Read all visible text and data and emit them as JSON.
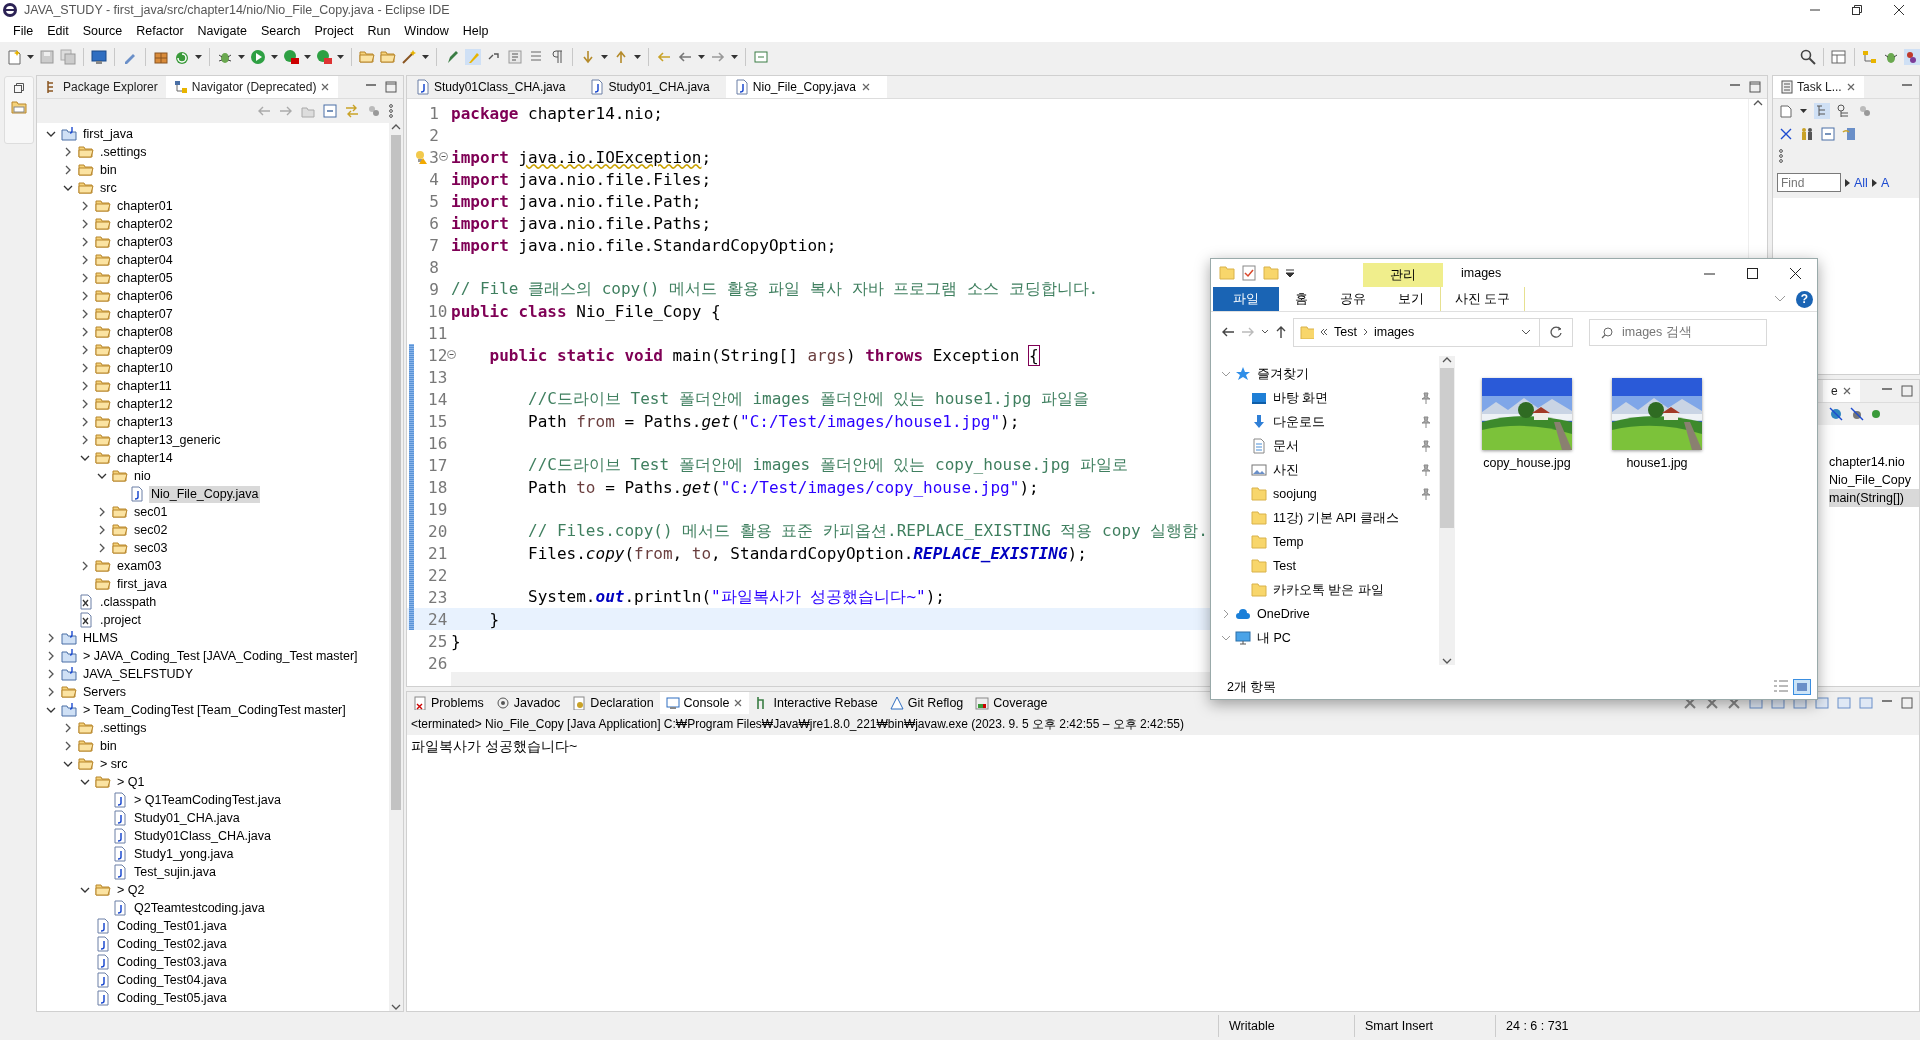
{
  "window": {
    "title": "JAVA_STUDY - first_java/src/chapter14/nio/Nio_File_Copy.java - Eclipse IDE"
  },
  "menu": [
    "File",
    "Edit",
    "Source",
    "Refactor",
    "Navigate",
    "Search",
    "Project",
    "Run",
    "Window",
    "Help"
  ],
  "left_panel": {
    "tabs": [
      {
        "label": "Package Explorer",
        "selected": false
      },
      {
        "label": "Navigator (Deprecated)",
        "selected": true
      }
    ],
    "tree": [
      {
        "label": "first_java",
        "kind": "project",
        "expanded": true,
        "selected": false,
        "children": [
          {
            "label": ".settings",
            "kind": "folder",
            "expanded": false,
            "selected": false
          },
          {
            "label": "bin",
            "kind": "folder",
            "expanded": false,
            "selected": false
          },
          {
            "label": "src",
            "kind": "folder",
            "expanded": true,
            "selected": false,
            "children": [
              {
                "label": "chapter01",
                "kind": "folder",
                "expanded": false,
                "selected": false
              },
              {
                "label": "chapter02",
                "kind": "folder",
                "expanded": false,
                "selected": false
              },
              {
                "label": "chapter03",
                "kind": "folder",
                "expanded": false,
                "selected": false
              },
              {
                "label": "chapter04",
                "kind": "folder",
                "expanded": false,
                "selected": false
              },
              {
                "label": "chapter05",
                "kind": "folder",
                "expanded": false,
                "selected": false
              },
              {
                "label": "chapter06",
                "kind": "folder",
                "expanded": false,
                "selected": false
              },
              {
                "label": "chapter07",
                "kind": "folder",
                "expanded": false,
                "selected": false
              },
              {
                "label": "chapter08",
                "kind": "folder",
                "expanded": false,
                "selected": false
              },
              {
                "label": "chapter09",
                "kind": "folder",
                "expanded": false,
                "selected": false
              },
              {
                "label": "chapter10",
                "kind": "folder",
                "expanded": false,
                "selected": false
              },
              {
                "label": "chapter11",
                "kind": "folder",
                "expanded": false,
                "selected": false
              },
              {
                "label": "chapter12",
                "kind": "folder",
                "expanded": false,
                "selected": false
              },
              {
                "label": "chapter13",
                "kind": "folder",
                "expanded": false,
                "selected": false
              },
              {
                "label": "chapter13_generic",
                "kind": "folder",
                "expanded": false,
                "selected": false
              },
              {
                "label": "chapter14",
                "kind": "folder",
                "expanded": true,
                "selected": false,
                "children": [
                  {
                    "label": "nio",
                    "kind": "folder",
                    "expanded": true,
                    "selected": false,
                    "children": [
                      {
                        "label": "Nio_File_Copy.java",
                        "kind": "java",
                        "selected": true
                      }
                    ]
                  },
                  {
                    "label": "sec01",
                    "kind": "folder",
                    "expanded": false,
                    "selected": false
                  },
                  {
                    "label": "sec02",
                    "kind": "folder",
                    "expanded": false,
                    "selected": false
                  },
                  {
                    "label": "sec03",
                    "kind": "folder",
                    "expanded": false,
                    "selected": false
                  }
                ]
              },
              {
                "label": "exam03",
                "kind": "folder",
                "expanded": false,
                "selected": false
              },
              {
                "label": "first_java",
                "kind": "folder",
                "selected": false
              }
            ]
          },
          {
            "label": ".classpath",
            "kind": "xml",
            "selected": false
          },
          {
            "label": ".project",
            "kind": "xml",
            "selected": false
          }
        ]
      },
      {
        "label": "HLMS",
        "kind": "project",
        "expanded": false,
        "selected": false
      },
      {
        "label": "> JAVA_Coding_Test [JAVA_Coding_Test master]",
        "kind": "project",
        "expanded": false,
        "selected": false
      },
      {
        "label": "JAVA_SELFSTUDY",
        "kind": "project",
        "expanded": false,
        "selected": false
      },
      {
        "label": "Servers",
        "kind": "folder",
        "expanded": false,
        "selected": false
      },
      {
        "label": "> Team_CodingTest [Team_CodingTest master]",
        "kind": "project",
        "expanded": true,
        "selected": false,
        "children": [
          {
            "label": ".settings",
            "kind": "folder",
            "expanded": false,
            "selected": false
          },
          {
            "label": "bin",
            "kind": "folder",
            "expanded": false,
            "selected": false
          },
          {
            "label": "> src",
            "kind": "folder",
            "expanded": true,
            "selected": false,
            "children": [
              {
                "label": "> Q1",
                "kind": "folder",
                "expanded": true,
                "selected": false,
                "children": [
                  {
                    "label": "> Q1TeamCodingTest.java",
                    "kind": "java",
                    "selected": false
                  },
                  {
                    "label": "Study01_CHA.java",
                    "kind": "java",
                    "selected": false
                  },
                  {
                    "label": "Study01Class_CHA.java",
                    "kind": "java",
                    "selected": false
                  },
                  {
                    "label": "Study1_yong.java",
                    "kind": "java",
                    "selected": false
                  },
                  {
                    "label": "Test_sujin.java",
                    "kind": "java",
                    "selected": false
                  }
                ]
              },
              {
                "label": "> Q2",
                "kind": "folder",
                "expanded": true,
                "selected": false,
                "children": [
                  {
                    "label": "Q2Teamtestcoding.java",
                    "kind": "java",
                    "selected": false
                  }
                ]
              },
              {
                "label": "Coding_Test01.java",
                "kind": "java",
                "selected": false
              },
              {
                "label": "Coding_Test02.java",
                "kind": "java",
                "selected": false
              },
              {
                "label": "Coding_Test03.java",
                "kind": "java",
                "selected": false
              },
              {
                "label": "Coding_Test04.java",
                "kind": "java",
                "selected": false
              },
              {
                "label": "Coding_Test05.java",
                "kind": "java",
                "selected": false
              }
            ]
          }
        ]
      }
    ]
  },
  "editor": {
    "tabs": [
      {
        "label": "Study01Class_CHA.java",
        "selected": false
      },
      {
        "label": "Study01_CHA.java",
        "selected": false
      },
      {
        "label": "Nio_File_Copy.java",
        "selected": true
      }
    ],
    "lines": [
      {
        "number": "1",
        "changed": false,
        "current": false,
        "fold": false,
        "warning": false,
        "tokens": [
          {
            "kind": "keyword",
            "text": "package"
          },
          {
            "kind": "plain",
            "text": " chapter14.nio;"
          }
        ]
      },
      {
        "number": "2",
        "changed": false,
        "current": false,
        "fold": false,
        "warning": false
      },
      {
        "number": "3",
        "changed": false,
        "current": false,
        "fold": true,
        "warning": true,
        "tokens": [
          {
            "kind": "keyword",
            "text": "import "
          },
          {
            "kind": "unused",
            "text": "java.io.IOException"
          },
          {
            "kind": "plain",
            "text": ";"
          }
        ]
      },
      {
        "number": "4",
        "changed": false,
        "current": false,
        "fold": false,
        "warning": false,
        "tokens": [
          {
            "kind": "keyword",
            "text": "import"
          },
          {
            "kind": "plain",
            "text": " java.nio.file.Files;"
          }
        ]
      },
      {
        "number": "5",
        "changed": false,
        "current": false,
        "fold": false,
        "warning": false,
        "tokens": [
          {
            "kind": "keyword",
            "text": "import"
          },
          {
            "kind": "plain",
            "text": " java.nio.file.Path;"
          }
        ]
      },
      {
        "number": "6",
        "changed": false,
        "current": false,
        "fold": false,
        "warning": false,
        "tokens": [
          {
            "kind": "keyword",
            "text": "import"
          },
          {
            "kind": "plain",
            "text": " java.nio.file.Paths;"
          }
        ]
      },
      {
        "number": "7",
        "changed": false,
        "current": false,
        "fold": false,
        "warning": false,
        "tokens": [
          {
            "kind": "keyword",
            "text": "import"
          },
          {
            "kind": "plain",
            "text": " java.nio.file.StandardCopyOption;"
          }
        ]
      },
      {
        "number": "8",
        "changed": false,
        "current": false,
        "fold": false,
        "warning": false
      },
      {
        "number": "9",
        "changed": false,
        "current": false,
        "fold": false,
        "warning": false,
        "tokens": [
          {
            "kind": "comment",
            "text": "// File 클래스의 copy() 메서드 활용 파일 복사 자바 프로그램 소스 코딩합니다."
          }
        ]
      },
      {
        "number": "10",
        "changed": false,
        "current": false,
        "fold": false,
        "warning": false,
        "tokens": [
          {
            "kind": "keyword",
            "text": "public "
          },
          {
            "kind": "keyword",
            "text": "class"
          },
          {
            "kind": "plain",
            "text": " Nio_File_Copy {"
          }
        ]
      },
      {
        "number": "11",
        "changed": false,
        "current": false,
        "fold": false,
        "warning": false
      },
      {
        "number": "12",
        "changed": true,
        "current": false,
        "fold": true,
        "warning": false,
        "tokens": [
          {
            "kind": "keyword",
            "text": "    public "
          },
          {
            "kind": "keyword",
            "text": "static "
          },
          {
            "kind": "keyword",
            "text": "void"
          },
          {
            "kind": "plain",
            "text": " main(String[] "
          },
          {
            "kind": "variable",
            "text": "args"
          },
          {
            "kind": "plain",
            "text": ") "
          },
          {
            "kind": "keyword",
            "text": "throws"
          },
          {
            "kind": "plain",
            "text": " Exception "
          },
          {
            "kind": "bracket",
            "text": "{"
          }
        ]
      },
      {
        "number": "13",
        "changed": true,
        "current": false,
        "fold": false,
        "warning": false
      },
      {
        "number": "14",
        "changed": true,
        "current": false,
        "fold": false,
        "warning": false,
        "tokens": [
          {
            "kind": "comment",
            "text": "        //C드라이브 Test 폴더안에 images 폴더안에 있는 house1.jpg 파일을"
          }
        ]
      },
      {
        "number": "15",
        "changed": true,
        "current": false,
        "fold": false,
        "warning": false,
        "tokens": [
          {
            "kind": "plain",
            "text": "        Path "
          },
          {
            "kind": "variable",
            "text": "from"
          },
          {
            "kind": "plain",
            "text": " = Paths."
          },
          {
            "kind": "method",
            "text": "get"
          },
          {
            "kind": "plain",
            "text": "("
          },
          {
            "kind": "string",
            "text": "\"C:/Test/images/house1.jpg\""
          },
          {
            "kind": "plain",
            "text": ");"
          }
        ]
      },
      {
        "number": "16",
        "changed": true,
        "current": false,
        "fold": false,
        "warning": false
      },
      {
        "number": "17",
        "changed": true,
        "current": false,
        "fold": false,
        "warning": false,
        "tokens": [
          {
            "kind": "comment",
            "text": "        //C드라이브 Test 폴더안에 images 폴더안에 있는 copy_house.jpg 파일로"
          }
        ]
      },
      {
        "number": "18",
        "changed": true,
        "current": false,
        "fold": false,
        "warning": false,
        "tokens": [
          {
            "kind": "plain",
            "text": "        Path "
          },
          {
            "kind": "variable",
            "text": "to"
          },
          {
            "kind": "plain",
            "text": " = Paths."
          },
          {
            "kind": "method",
            "text": "get"
          },
          {
            "kind": "plain",
            "text": "("
          },
          {
            "kind": "string",
            "text": "\"C:/Test/images/copy_house.jpg\""
          },
          {
            "kind": "plain",
            "text": ");"
          }
        ]
      },
      {
        "number": "19",
        "changed": true,
        "current": false,
        "fold": false,
        "warning": false
      },
      {
        "number": "20",
        "changed": true,
        "current": false,
        "fold": false,
        "warning": false,
        "tokens": [
          {
            "kind": "comment",
            "text": "        // Files.copy() 메서드 활용 표준 카피옵션.REPLACE_EXISTING 적용 copy 실행함."
          }
        ]
      },
      {
        "number": "21",
        "changed": true,
        "current": false,
        "fold": false,
        "warning": false,
        "tokens": [
          {
            "kind": "plain",
            "text": "        Files."
          },
          {
            "kind": "method",
            "text": "copy"
          },
          {
            "kind": "plain",
            "text": "("
          },
          {
            "kind": "variable",
            "text": "from"
          },
          {
            "kind": "plain",
            "text": ", "
          },
          {
            "kind": "variable",
            "text": "to"
          },
          {
            "kind": "plain",
            "text": ", StandardCopyOption."
          },
          {
            "kind": "constant",
            "text": "REPLACE_EXISTING"
          },
          {
            "kind": "plain",
            "text": ");"
          }
        ]
      },
      {
        "number": "22",
        "changed": true,
        "current": false,
        "fold": false,
        "warning": false
      },
      {
        "number": "23",
        "changed": true,
        "current": false,
        "fold": false,
        "warning": false,
        "tokens": [
          {
            "kind": "plain",
            "text": "        System."
          },
          {
            "kind": "constant",
            "text": "out"
          },
          {
            "kind": "plain",
            "text": ".println("
          },
          {
            "kind": "string",
            "text": "\"파일복사가 성공했습니다~\""
          },
          {
            "kind": "plain",
            "text": ");"
          }
        ]
      },
      {
        "number": "24",
        "changed": true,
        "current": true,
        "fold": false,
        "warning": false,
        "tokens": [
          {
            "kind": "plain",
            "text": "    }"
          }
        ]
      },
      {
        "number": "25",
        "changed": false,
        "current": false,
        "fold": false,
        "warning": false,
        "tokens": [
          {
            "kind": "plain",
            "text": "}"
          }
        ]
      },
      {
        "number": "26",
        "changed": false,
        "current": false,
        "fold": false,
        "warning": false
      }
    ]
  },
  "task_list": {
    "tab": "Task L...",
    "find": {
      "placeholder": "Find"
    },
    "links": [
      "All",
      "A"
    ]
  },
  "outline": {
    "tab": "e",
    "items": [
      {
        "label": "chapter14.nio",
        "selected": false
      },
      {
        "label": "Nio_File_Copy",
        "selected": false
      },
      {
        "label": "main(String[])",
        "selected": true
      }
    ]
  },
  "bottom_panel": {
    "tabs": [
      {
        "label": "Problems",
        "selected": false
      },
      {
        "label": "Javadoc",
        "selected": false
      },
      {
        "label": "Declaration",
        "selected": false
      },
      {
        "label": "Console",
        "selected": true
      },
      {
        "label": "Interactive Rebase",
        "selected": false
      },
      {
        "label": "Git Reflog",
        "selected": false
      },
      {
        "label": "Coverage",
        "selected": false
      }
    ],
    "console_header": "<terminated> Nio_File_Copy [Java Application] C:₩Program Files₩Java₩jre1.8.0_221₩bin₩javaw.exe  (2023. 9. 5 오후 2:42:55 – 오후 2:42:55)",
    "output": "파일복사가 성공했습니다~"
  },
  "status_bar": [
    "Writable",
    "Smart Insert",
    "24 : 6 : 731"
  ],
  "file_explorer": {
    "title": "images",
    "context_group": "관리",
    "ribbon_tabs": [
      {
        "label": "파일",
        "kind": "file",
        "selected": true
      },
      {
        "label": "홈",
        "kind": "normal",
        "selected": false
      },
      {
        "label": "공유",
        "kind": "normal",
        "selected": false
      },
      {
        "label": "보기",
        "kind": "normal",
        "selected": false
      },
      {
        "label": "사진 도구",
        "kind": "contextual",
        "selected": false
      }
    ],
    "help": "?",
    "address": [
      "Test",
      "images"
    ],
    "search": {
      "placeholder": "images 검색"
    },
    "nav": [
      {
        "label": "즐겨찾기",
        "kind": "star",
        "expanded": true,
        "children": [
          {
            "label": "바탕 화면",
            "kind": "desktop",
            "pinned": true
          },
          {
            "label": "다운로드",
            "kind": "download",
            "pinned": true
          },
          {
            "label": "문서",
            "kind": "document",
            "pinned": true
          },
          {
            "label": "사진",
            "kind": "photos",
            "pinned": true
          },
          {
            "label": "soojung",
            "kind": "folder",
            "pinned": true
          },
          {
            "label": "11강) 기본 API 클래스",
            "kind": "folder",
            "pinned": false
          },
          {
            "label": "Temp",
            "kind": "folder",
            "pinned": false
          },
          {
            "label": "Test",
            "kind": "folder",
            "pinned": false
          },
          {
            "label": "카카오톡 받은 파일",
            "kind": "folder",
            "pinned": false
          }
        ]
      },
      {
        "label": "OneDrive",
        "kind": "cloud",
        "expanded": false
      },
      {
        "label": "내 PC",
        "kind": "pc",
        "expanded": true
      }
    ],
    "files": [
      {
        "name": "copy_house.jpg",
        "kind": "picture"
      },
      {
        "name": "house1.jpg",
        "kind": "picture"
      }
    ],
    "status": "2개 항목"
  }
}
